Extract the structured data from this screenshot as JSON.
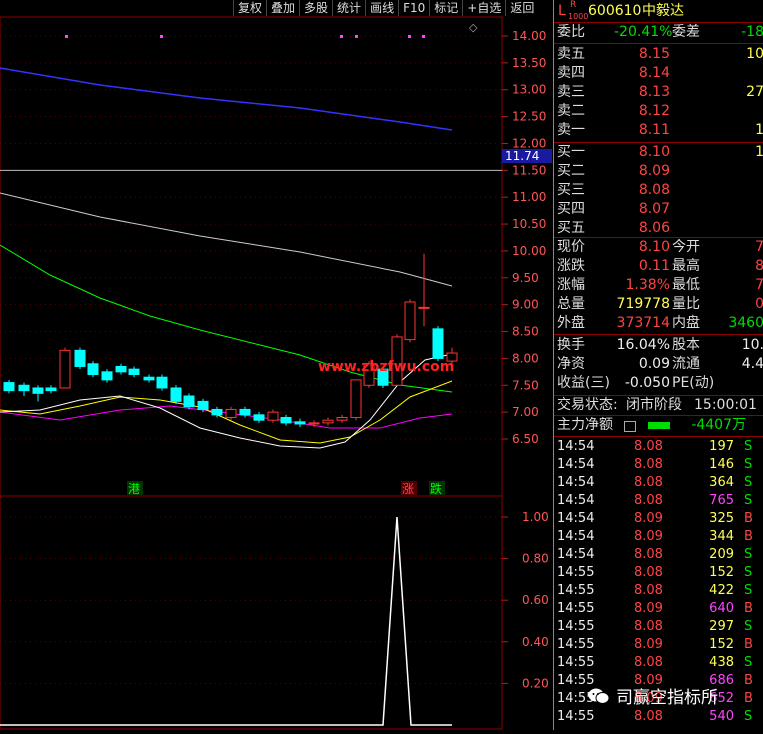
{
  "toolbar": [
    "复权",
    "叠加",
    "多股",
    "统计",
    "画线",
    "F10",
    "标记",
    "+自选",
    "返回"
  ],
  "chart": {
    "price_ticks": [
      "14.00",
      "13.50",
      "13.00",
      "12.50",
      "12.00",
      "11.50",
      "11.00",
      "10.50",
      "10.00",
      "9.50",
      "9.00",
      "8.50",
      "8.00",
      "7.50",
      "7.00",
      "6.50"
    ],
    "price_marker": "11.74",
    "indicator_ticks": [
      "1.00",
      "0.80",
      "0.60",
      "0.40",
      "0.20"
    ],
    "watermark": "www.zbzfwu.com",
    "tags": {
      "gang": "港",
      "zhang": "涨",
      "die": "跌"
    },
    "colors": {
      "up": "#ff3333",
      "down": "#00ffff",
      "ma1": "#ffffff",
      "ma2": "#ffff00",
      "ma3": "#ff00ff",
      "ma4": "#00ff00",
      "ma5": "#cccccc",
      "ma6": "#3333ff"
    }
  },
  "header": {
    "code": "600610",
    "name": "中毅达",
    "l_label": "L",
    "r_label": "R",
    "sub": "1000"
  },
  "weibi": {
    "label": "委比",
    "value": "-20.41%",
    "wc_label": "委差",
    "wc_value": "-18"
  },
  "asks": [
    {
      "label": "卖五",
      "price": "8.15",
      "vol": "10"
    },
    {
      "label": "卖四",
      "price": "8.14",
      "vol": ""
    },
    {
      "label": "卖三",
      "price": "8.13",
      "vol": "27"
    },
    {
      "label": "卖二",
      "price": "8.12",
      "vol": ""
    },
    {
      "label": "卖一",
      "price": "8.11",
      "vol": "1"
    }
  ],
  "bids": [
    {
      "label": "买一",
      "price": "8.10",
      "vol": "1"
    },
    {
      "label": "买二",
      "price": "8.09",
      "vol": ""
    },
    {
      "label": "买三",
      "price": "8.08",
      "vol": ""
    },
    {
      "label": "买四",
      "price": "8.07",
      "vol": ""
    },
    {
      "label": "买五",
      "price": "8.06",
      "vol": ""
    }
  ],
  "quote": [
    {
      "l": "现价",
      "v": "8.10",
      "l2": "今开",
      "v2": "7"
    },
    {
      "l": "涨跌",
      "v": "0.11",
      "l2": "最高",
      "v2": "8"
    },
    {
      "l": "涨幅",
      "v": "1.38%",
      "l2": "最低",
      "v2": "7"
    },
    {
      "l": "总量",
      "v": "719778",
      "l2": "量比",
      "v2": "0"
    },
    {
      "l": "外盘",
      "v": "373714",
      "l2": "内盘",
      "v2": "3460"
    }
  ],
  "stats": [
    {
      "l": "换手",
      "v": "16.04%",
      "l2": "股本",
      "v2": "10."
    },
    {
      "l": "净资",
      "v": "0.09",
      "l2": "流通",
      "v2": "4.4"
    },
    {
      "l": "收益(三)",
      "v": "-0.050",
      "l2": "PE(动)",
      "v2": ""
    }
  ],
  "status": {
    "label": "交易状态:",
    "value": "闭市阶段",
    "time": "15:00:01"
  },
  "netflow": {
    "label": "主力净额",
    "value": "-4407万"
  },
  "ticks": [
    [
      "14:54",
      "8.08",
      "197",
      "S"
    ],
    [
      "14:54",
      "8.08",
      "146",
      "S"
    ],
    [
      "14:54",
      "8.08",
      "364",
      "S"
    ],
    [
      "14:54",
      "8.08",
      "765",
      "S"
    ],
    [
      "14:54",
      "8.09",
      "325",
      "B"
    ],
    [
      "14:54",
      "8.09",
      "344",
      "B"
    ],
    [
      "14:54",
      "8.08",
      "209",
      "S"
    ],
    [
      "14:55",
      "8.08",
      "152",
      "S"
    ],
    [
      "14:55",
      "8.08",
      "422",
      "S"
    ],
    [
      "14:55",
      "8.09",
      "640",
      "B"
    ],
    [
      "14:55",
      "8.08",
      "297",
      "S"
    ],
    [
      "14:55",
      "8.09",
      "152",
      "B"
    ],
    [
      "14:55",
      "8.08",
      "438",
      "S"
    ],
    [
      "14:55",
      "8.09",
      "686",
      "B"
    ],
    [
      "14:55",
      "8.09",
      "652",
      "B"
    ],
    [
      "14:55",
      "8.08",
      "540",
      "S"
    ]
  ],
  "brand": "司赢空指标所"
}
